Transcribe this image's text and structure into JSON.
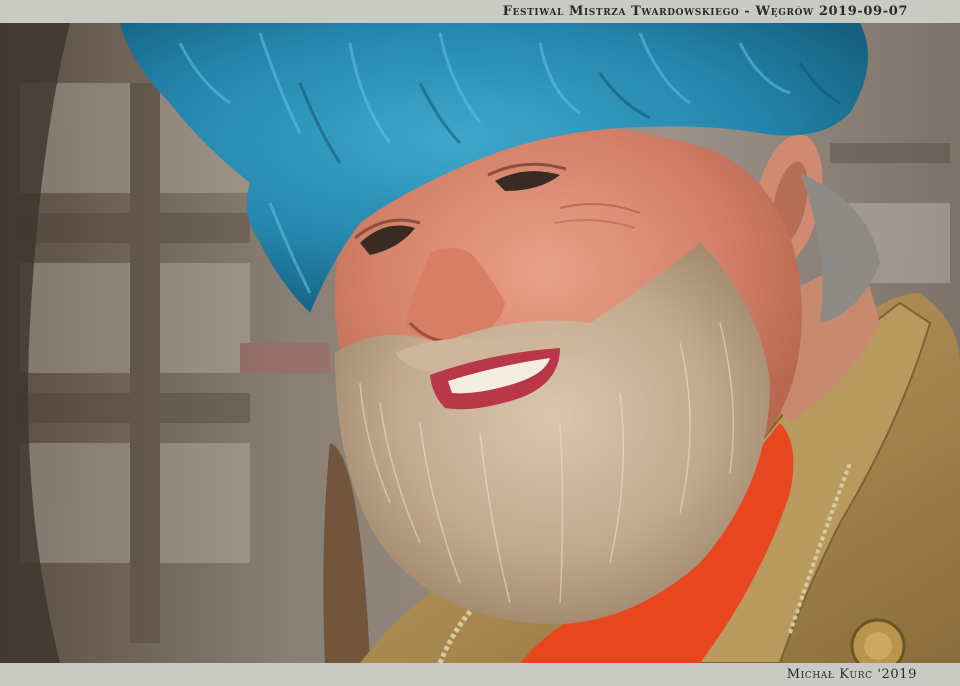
{
  "header": {
    "caption": "Festiwal Mistrza Twardowskiego  - Węgrów 2019-09-07"
  },
  "footer": {
    "credit": "Michał Kurc '2019"
  },
  "photo": {
    "subject": "portrait-photo",
    "colors": {
      "hat": "#2a90b4",
      "skin": "#d98d76",
      "beard": "#c7b39b",
      "coat": "#a98950",
      "shirt": "#e8461e",
      "background": "#6b5e52"
    }
  }
}
